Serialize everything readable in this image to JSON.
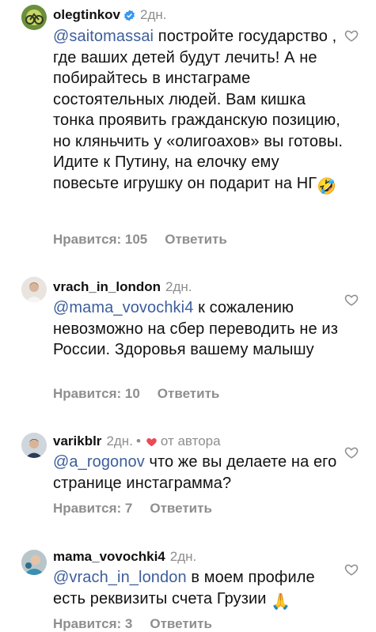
{
  "comments": [
    {
      "username": "olegtinkov",
      "time": "2дн.",
      "mention": "@saitomassai",
      "text": " постройте государство , где ваших детей будут лечить! А не побирайтесь в инстаграме состоятельных людей. Вам кишка тонка проявить гражданскую позицию, но кляньчить у «олигоахов» вы готовы. Идите к Путину, на елочку ему повесьте игрушку он подарит на НГ",
      "emoji": "🤣",
      "likes": "Нравится: 105",
      "reply": "Ответить"
    },
    {
      "username": "vrach_in_london",
      "time": "2дн.",
      "mention": "@mama_vovochki4",
      "text": " к сожалению невозможно на сбер переводить не из России. Здоровья вашему малышу",
      "likes": "Нравится: 10",
      "reply": "Ответить"
    },
    {
      "username": "varikblr",
      "time": "2дн.",
      "dot": "•",
      "author_label": "от автора",
      "mention": "@a_rogonov",
      "text": " что же вы делаете на его странице инстаграмма?",
      "likes": "Нравится: 7",
      "reply": "Ответить"
    },
    {
      "username": "mama_vovochki4",
      "time": "2дн.",
      "mention": "@vrach_in_london",
      "text": " в моем профиле есть реквизиты счета Грузии",
      "emoji": "🙏",
      "likes": "Нравится: 3",
      "reply": "Ответить"
    }
  ],
  "colors": {
    "mention": "#3d5e9b",
    "meta": "#8e8e8e",
    "verified": "#3897f0",
    "author_heart": "#ed4956"
  }
}
